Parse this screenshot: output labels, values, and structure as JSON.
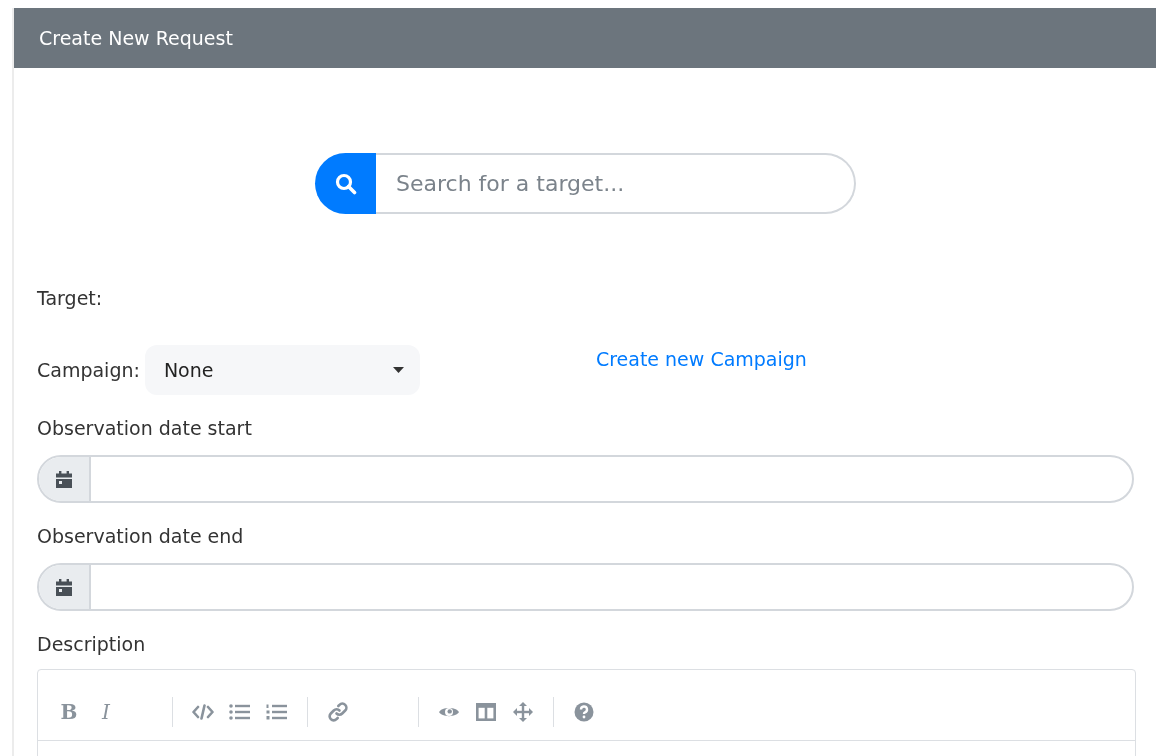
{
  "header": {
    "title": "Create New Request"
  },
  "search": {
    "placeholder": "Search for a target..."
  },
  "target": {
    "label": "Target:"
  },
  "campaign": {
    "label": "Campaign:",
    "value": "None",
    "link": "Create new Campaign"
  },
  "date_fields": [
    {
      "label": "Observation date start"
    },
    {
      "label": "Observation date end"
    }
  ],
  "description": {
    "label": "Description",
    "toolbar": [
      {
        "kind": "bold",
        "label": "B"
      },
      {
        "kind": "italic",
        "label": "I"
      },
      {
        "kind": "separator"
      },
      {
        "kind": "code"
      },
      {
        "kind": "bullet-list"
      },
      {
        "kind": "numbered-list"
      },
      {
        "kind": "separator"
      },
      {
        "kind": "link"
      },
      {
        "kind": "separator"
      },
      {
        "kind": "preview"
      },
      {
        "kind": "side-by-side"
      },
      {
        "kind": "fullscreen"
      },
      {
        "kind": "separator"
      },
      {
        "kind": "help"
      }
    ]
  }
}
